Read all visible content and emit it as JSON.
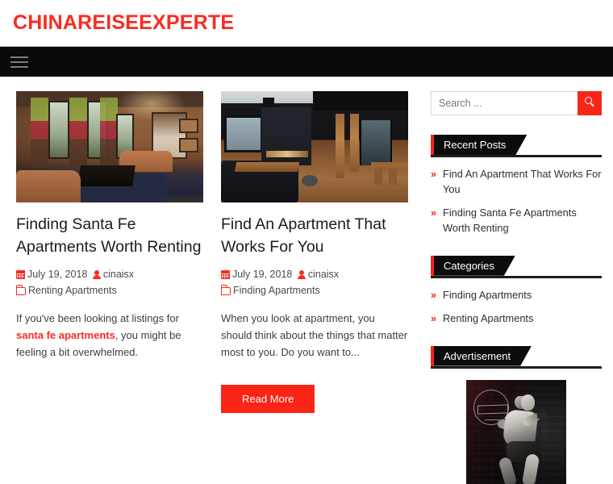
{
  "header": {
    "site_title": "CHINAREISEEXPERTE",
    "menu_icon": "hamburger-icon"
  },
  "posts": [
    {
      "title": "Finding Santa Fe Apartments Worth Renting",
      "thumb_alt": "warm-living-room-interior",
      "date": "July 19, 2018",
      "author": "cinaisx",
      "category": "Renting Apartments",
      "excerpt_before": "If you've been looking at listings for ",
      "excerpt_link": "santa fe apartments",
      "excerpt_after": ", you might be feeling a bit overwhelmed.",
      "has_read_more": false
    },
    {
      "title": "Find An Apartment That Works For You",
      "thumb_alt": "modern-dark-loft-interior",
      "date": "July 19, 2018",
      "author": "cinaisx",
      "category": "Finding Apartments",
      "excerpt_before": "When you look at apartment, you should think about the things that matter most to you. Do you want to...",
      "excerpt_link": "",
      "excerpt_after": "",
      "read_more_label": "Read More"
    }
  ],
  "sidebar": {
    "search": {
      "placeholder": "Search ...",
      "value": "",
      "button_icon": "search-icon"
    },
    "widgets": [
      {
        "title": "Recent Posts",
        "items": [
          "Find An Apartment That Works For You",
          "Finding Santa Fe Apartments Worth Renting"
        ]
      },
      {
        "title": "Categories",
        "items": [
          "Finding Apartments",
          "Renting Apartments"
        ]
      },
      {
        "title": "Advertisement",
        "items": []
      }
    ],
    "advertisement_alt": "fitness-woman-with-dumbbells"
  },
  "colors": {
    "accent_red": "#fa2417",
    "title_red": "#fa2b20",
    "nav_black": "#0a0a0a",
    "banner_black": "#0c0c0c"
  }
}
